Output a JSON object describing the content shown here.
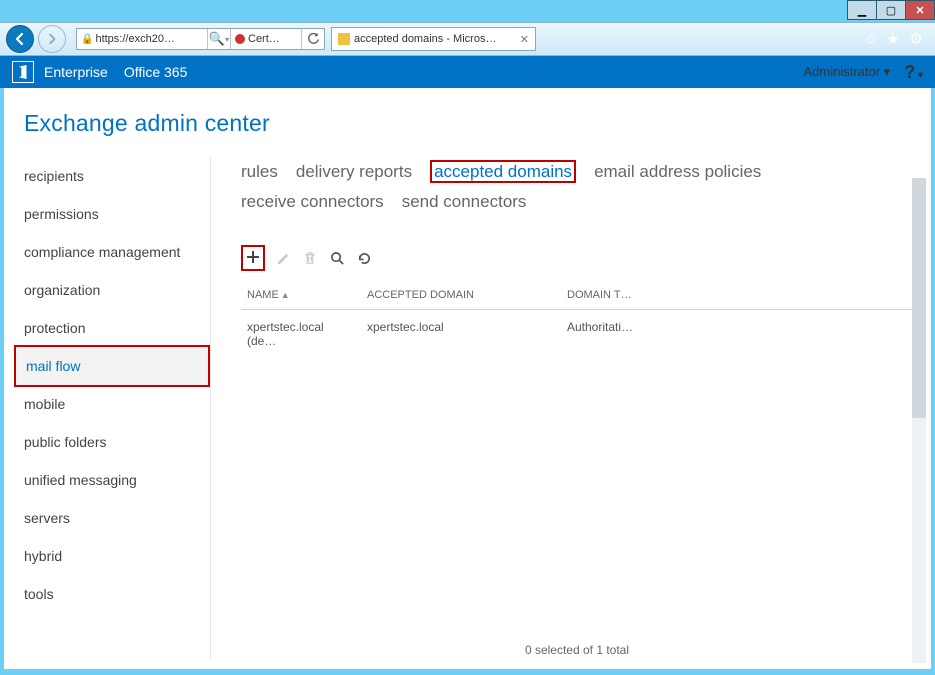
{
  "window": {
    "minimize": "_",
    "maximize": "□",
    "close": "✕"
  },
  "browser": {
    "address": "https://exch20…",
    "cert_tab": "Cert…",
    "tab_title": "accepted domains - Micros…"
  },
  "header": {
    "enterprise": "Enterprise",
    "office365": "Office 365",
    "admin_label": "Administrator",
    "help": "?"
  },
  "page_title": "Exchange admin center",
  "leftnav": {
    "items": [
      {
        "label": "recipients"
      },
      {
        "label": "permissions"
      },
      {
        "label": "compliance management"
      },
      {
        "label": "organization"
      },
      {
        "label": "protection"
      },
      {
        "label": "mail flow",
        "active": true
      },
      {
        "label": "mobile"
      },
      {
        "label": "public folders"
      },
      {
        "label": "unified messaging"
      },
      {
        "label": "servers"
      },
      {
        "label": "hybrid"
      },
      {
        "label": "tools"
      }
    ]
  },
  "tabs": {
    "row1": [
      {
        "label": "rules"
      },
      {
        "label": "delivery reports"
      },
      {
        "label": "accepted domains",
        "active": true
      },
      {
        "label": "email address policies"
      }
    ],
    "row2": [
      {
        "label": "receive connectors"
      },
      {
        "label": "send connectors"
      }
    ]
  },
  "toolbar": {
    "add": "＋",
    "edit": "✎",
    "delete": "🗑",
    "search": "🔍",
    "refresh": "⟳"
  },
  "table": {
    "cols": {
      "name": "NAME",
      "domain": "ACCEPTED DOMAIN",
      "type": "DOMAIN T…"
    },
    "rows": [
      {
        "name": "xpertstec.local (de…",
        "domain": "xpertstec.local",
        "type": "Authoritati…"
      }
    ],
    "status": "0 selected of 1 total"
  }
}
